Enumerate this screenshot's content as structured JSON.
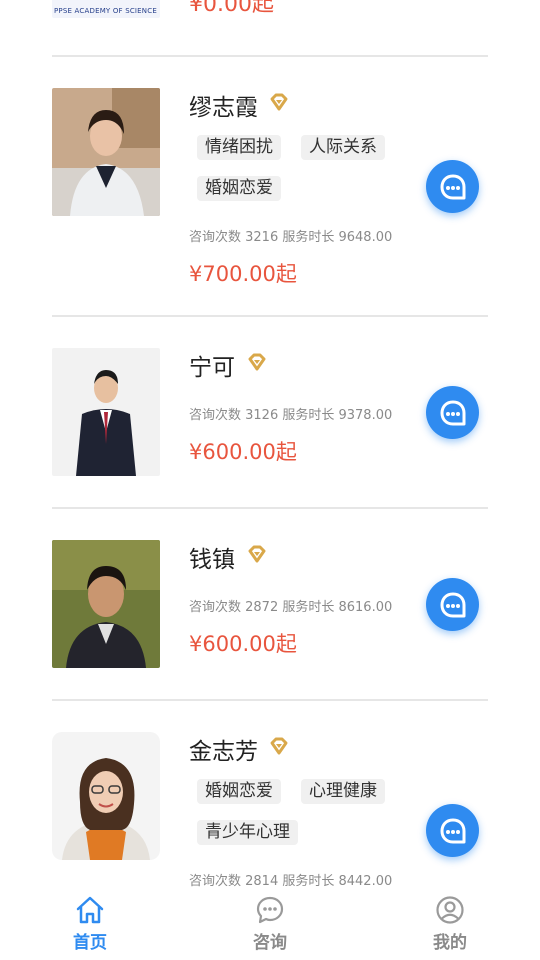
{
  "top_partial": {
    "logo_text": "PPSE ACADEMY OF SCIENCE",
    "price": "¥0.00起"
  },
  "counselors": [
    {
      "name": "缪志霞",
      "tags": [
        "情绪困扰",
        "人际关系",
        "婚姻恋爱"
      ],
      "stats": "咨询次数 3216 服务时长 9648.00",
      "price": "¥700.00起"
    },
    {
      "name": "宁可",
      "tags": [],
      "stats": "咨询次数 3126 服务时长 9378.00",
      "price": "¥600.00起"
    },
    {
      "name": "钱镇",
      "tags": [],
      "stats": "咨询次数 2872 服务时长 8616.00",
      "price": "¥600.00起"
    },
    {
      "name": "金志芳",
      "tags": [
        "婚姻恋爱",
        "心理健康",
        "青少年心理"
      ],
      "stats": "咨询次数 2814 服务时长 8442.00",
      "price": ""
    }
  ],
  "tabbar": {
    "tabs": [
      {
        "label": "首页",
        "icon": "home-icon",
        "active": true
      },
      {
        "label": "咨询",
        "icon": "chat-bubble-icon",
        "active": false
      },
      {
        "label": "我的",
        "icon": "profile-icon",
        "active": false
      }
    ]
  },
  "colors": {
    "accent": "#2f8bf0",
    "price": "#e8553e",
    "badge": "#d9a84a",
    "muted": "#8a8a8a"
  }
}
